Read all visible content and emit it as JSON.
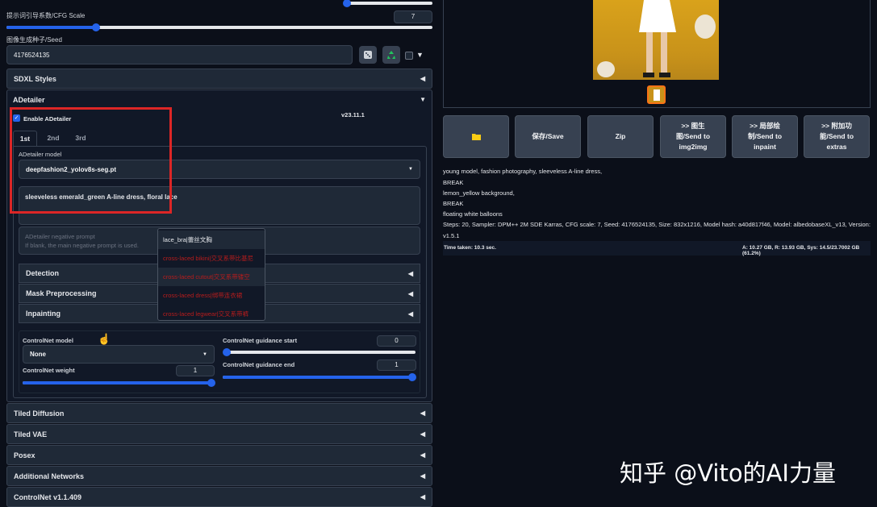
{
  "cfg": {
    "label": "提示词引导系数/CFG Scale",
    "value": "7",
    "fraction": 0.23
  },
  "steps_slider": {
    "fraction": 0.77
  },
  "seed": {
    "label": "图像生成种子/Seed",
    "value": "4176524135"
  },
  "sdxl_styles": {
    "label": "SDXL Styles"
  },
  "adetailer": {
    "label": "ADetailer",
    "enable_label": "Enable ADetailer",
    "enabled": true,
    "version": "v23.11.1",
    "tabs": [
      "1st",
      "2nd",
      "3rd"
    ],
    "model_label": "ADetailer model",
    "model_value": "deepfashion2_yolov8s-seg.pt",
    "prompt": "sleeveless emerald_green A-line dress, floral lace",
    "neg_placeholder_1": "ADetailer negative prompt",
    "neg_placeholder_2": "If blank, the main negative prompt is used.",
    "autocomplete": {
      "header": "lace_bra|蕾丝文胸",
      "items": [
        "cross-laced bikini|交叉系带比基尼",
        "cross-laced cutout|交叉系带镂空",
        "cross-laced dress|绑带连衣裙",
        "cross-laced legwear|交叉系带裤"
      ]
    },
    "sub_sections": [
      "Detection",
      "Mask Preprocessing",
      "Inpainting"
    ],
    "controlnet": {
      "model_label": "ControlNet model",
      "model_value": "None",
      "weight_label": "ControlNet weight",
      "weight_value": "1",
      "weight_fraction": 1.0,
      "start_label": "ControlNet guidance start",
      "start_value": "0",
      "start_fraction": 0.0,
      "end_label": "ControlNet guidance end",
      "end_value": "1",
      "end_fraction": 1.0
    }
  },
  "accordions": [
    "Tiled Diffusion",
    "Tiled VAE",
    "Posex",
    "Additional Networks",
    "ControlNet v1.1.409"
  ],
  "buttons": {
    "folder_icon": "folder-icon",
    "save": "保存/Save",
    "zip": "Zip",
    "img2img_1": ">> 图生",
    "img2img_2": "图/Send to",
    "img2img_3": "img2img",
    "inpaint_1": ">> 局部绘",
    "inpaint_2": "制/Send to",
    "inpaint_3": "inpaint",
    "extras_1": ">> 附加功",
    "extras_2": "能/Send to",
    "extras_3": "extras"
  },
  "generation_info": {
    "line1": "young model, fashion photography, sleeveless A-line dress,",
    "line2": "BREAK",
    "line3": "lemon_yellow background,",
    "line4": "BREAK",
    "line5": "floating white balloons",
    "line6": "Steps: 20, Sampler: DPM++ 2M SDE Karras, CFG scale: 7, Seed: 4176524135, Size: 832x1216, Model hash: a40d817f46, Model: albedobaseXL_v13, Version:",
    "line7": "v1.5.1"
  },
  "timing": {
    "time_taken": "Time taken: 10.3 sec.",
    "vram": "A: 10.27 GB, R: 13.93 GB, Sys: 14.5/23.7002 GB (61.2%)"
  },
  "watermark": "知乎 @Vito的AI力量",
  "colors": {
    "accent": "#2563eb",
    "highlight_box": "#dc2626",
    "background": "#0b0f19"
  }
}
